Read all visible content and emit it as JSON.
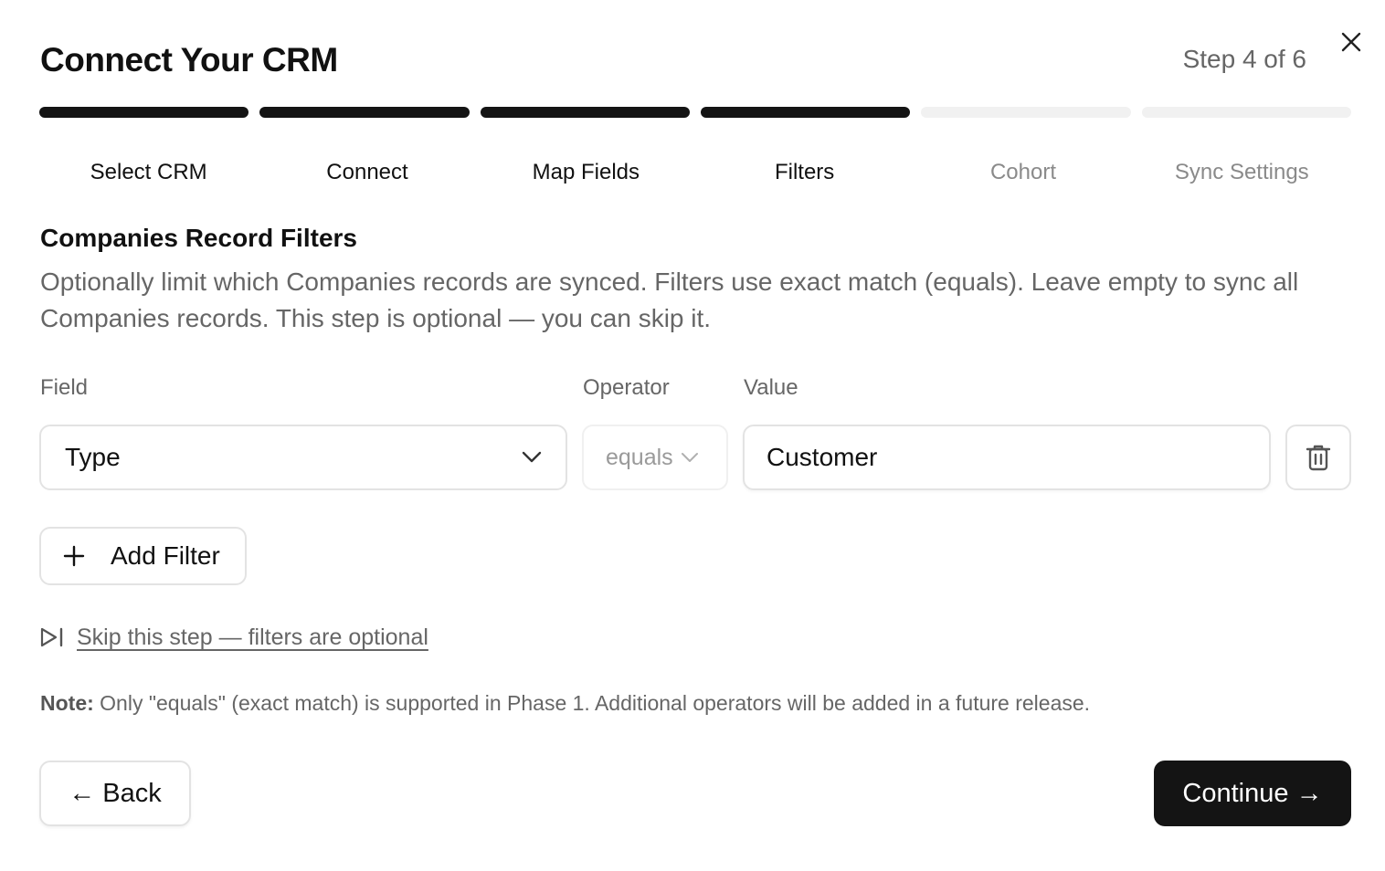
{
  "header": {
    "title": "Connect Your CRM",
    "step_indicator": "Step 4 of 6"
  },
  "progress": {
    "current_step": 4,
    "total_steps": 6
  },
  "steps": [
    {
      "label": "Select CRM",
      "state": "complete"
    },
    {
      "label": "Connect",
      "state": "complete"
    },
    {
      "label": "Map Fields",
      "state": "complete"
    },
    {
      "label": "Filters",
      "state": "current"
    },
    {
      "label": "Cohort",
      "state": "upcoming"
    },
    {
      "label": "Sync Settings",
      "state": "upcoming"
    }
  ],
  "section": {
    "title": "Companies Record Filters",
    "description": "Optionally limit which Companies records are synced. Filters use exact match (equals). Leave empty to sync all Companies records. This step is optional — you can skip it."
  },
  "columns": {
    "field": "Field",
    "operator": "Operator",
    "value": "Value"
  },
  "filter_row": {
    "field_value": "Type",
    "operator_value": "equals",
    "value": "Customer",
    "delete_icon": "trash-icon"
  },
  "actions": {
    "add_filter": "Add Filter",
    "skip_link": "Skip this step — filters are optional",
    "back": "← Back",
    "continue": "Continue →"
  },
  "note": {
    "label": "Note:",
    "text": " Only \"equals\" (exact match) is supported in Phase 1. Additional operators will be added in a future release."
  },
  "colors": {
    "primary": "#141414",
    "muted_text": "#666666",
    "border": "#e3e3e3",
    "progress_inactive": "#f1f1f1"
  }
}
